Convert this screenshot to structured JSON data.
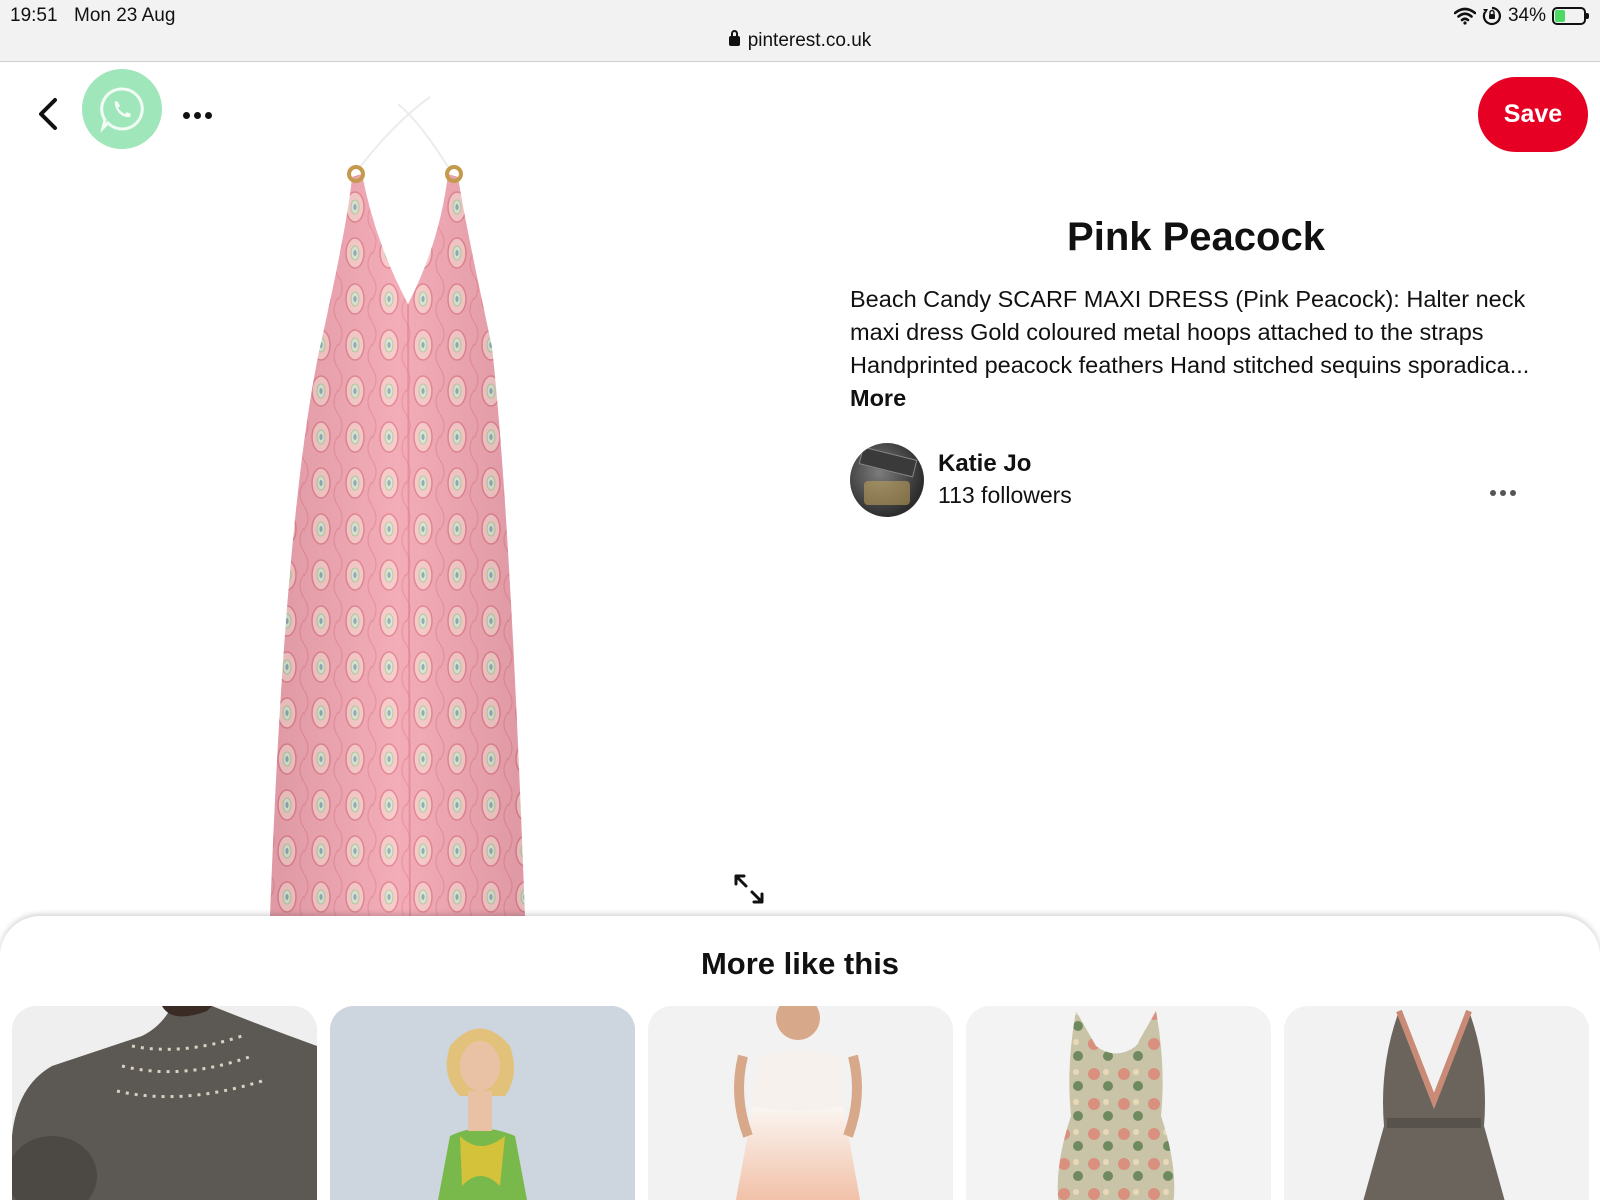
{
  "status_bar": {
    "time": "19:51",
    "date": "Mon 23 Aug",
    "url": "pinterest.co.uk",
    "battery": "34%",
    "battery_level": 0.34
  },
  "toolbar": {
    "save_label": "Save"
  },
  "pin": {
    "title": "Pink Peacock",
    "description": "Beach Candy SCARF MAXI DRESS (Pink Peacock): Halter neck maxi dress Gold coloured metal hoops attached to the straps Handprinted peacock feathers Hand stitched sequins sporadica...",
    "more_label": "More"
  },
  "creator": {
    "name": "Katie Jo",
    "followers": "113 followers"
  },
  "more_like_this": {
    "title": "More like this"
  },
  "colors": {
    "save_red": "#e60023",
    "whatsapp_green": "#9fe6bb",
    "dress_pink": "#f2a6b2"
  }
}
